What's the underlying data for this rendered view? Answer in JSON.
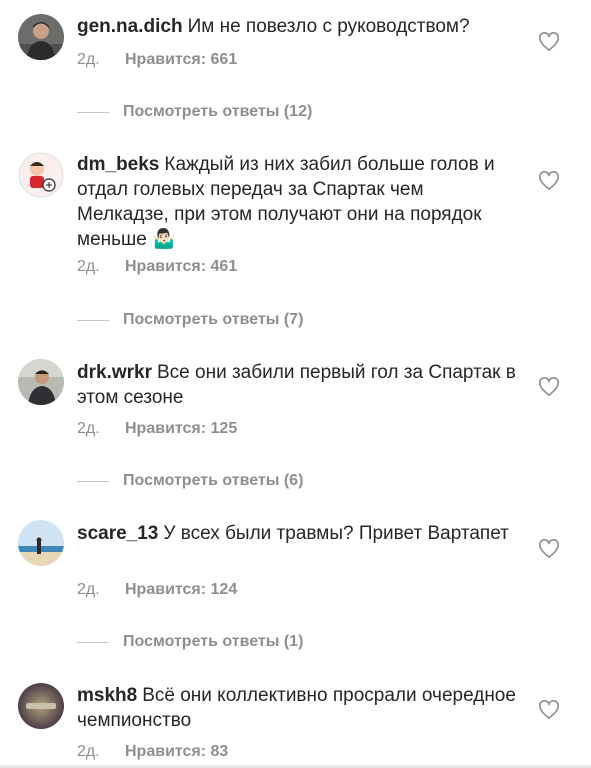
{
  "comments": [
    {
      "username": "gen.na.dich",
      "text": "Им не повезло с руководством?",
      "age": "2д.",
      "likes": "Нравится: 661",
      "replies": "Посмотреть ответы (12)"
    },
    {
      "username": "dm_beks",
      "text": "Каждый из них забил больше голов и отдал голевых передач за Спартак чем Мелкадзе, при этом получают они на порядок меньше 🤷🏻‍♂️",
      "age": "2д.",
      "likes": "Нравится: 461",
      "replies": "Посмотреть ответы (7)"
    },
    {
      "username": "drk.wrkr",
      "text": "Все они забили первый гол за Спартак в этом сезоне",
      "age": "2д.",
      "likes": "Нравится: 125",
      "replies": "Посмотреть ответы (6)"
    },
    {
      "username": "scare_13",
      "text": "У всех были травмы? Привет Вартапет",
      "age": "2д.",
      "likes": "Нравится: 124",
      "replies": "Посмотреть ответы (1)"
    },
    {
      "username": "mskh8",
      "text": "Всё они коллективно просрали очередное чемпионство",
      "age": "2д.",
      "likes": "Нравится: 83"
    }
  ],
  "icons": {
    "like": "heart-outline-icon"
  },
  "colors": {
    "text": "#262626",
    "secondary": "#8e8e8e",
    "divider": "#c7c7c7",
    "background": "#ffffff"
  }
}
